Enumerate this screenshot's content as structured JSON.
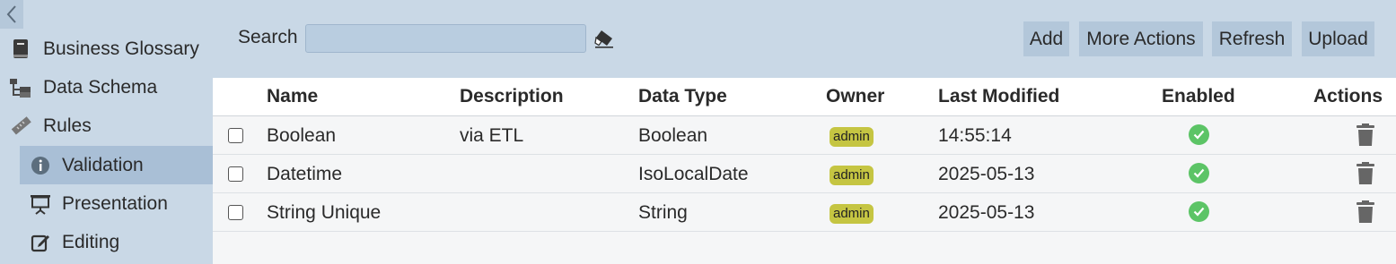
{
  "sidebar": {
    "items": [
      {
        "label": "Business Glossary",
        "icon": "book-icon"
      },
      {
        "label": "Data Schema",
        "icon": "schema-tree-icon"
      },
      {
        "label": "Rules",
        "icon": "ruler-icon"
      }
    ],
    "subitems": [
      {
        "label": "Validation",
        "icon": "info-circle-icon",
        "active": true
      },
      {
        "label": "Presentation",
        "icon": "presentation-icon"
      },
      {
        "label": "Editing",
        "icon": "edit-icon"
      }
    ]
  },
  "toolbar": {
    "search_label": "Search",
    "search_value": "",
    "add_label": "Add",
    "more_actions_label": "More Actions",
    "refresh_label": "Refresh",
    "upload_label": "Upload"
  },
  "table": {
    "columns": [
      "Name",
      "Description",
      "Data Type",
      "Owner",
      "Last Modified",
      "Enabled",
      "Actions"
    ],
    "rows": [
      {
        "name": "Boolean",
        "description": "via ETL",
        "data_type": "Boolean",
        "owner": "admin",
        "last_modified": "14:55:14",
        "enabled": true,
        "checked": false
      },
      {
        "name": "Datetime",
        "description": "",
        "data_type": "IsoLocalDate",
        "owner": "admin",
        "last_modified": "2025-05-13",
        "enabled": true,
        "checked": false
      },
      {
        "name": "String Unique",
        "description": "",
        "data_type": "String",
        "owner": "admin",
        "last_modified": "2025-05-13",
        "enabled": true,
        "checked": false
      }
    ]
  },
  "colors": {
    "background": "#c9d8e6",
    "active_item": "#a9bfd6",
    "owner_badge": "#c5c542",
    "enabled_check": "#5cc466"
  }
}
